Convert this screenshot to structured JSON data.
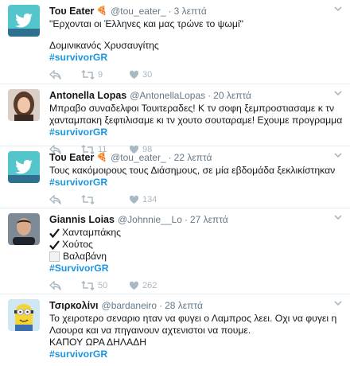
{
  "tweets": [
    {
      "name": "Του Eater",
      "emoji": "🍕",
      "handle": "@tou_eater_",
      "time": "3 λεπτά",
      "lines": [
        "\"Ερχονται οι Έλληνες και μας τρώνε το ψωμί\"",
        "",
        "Δομινικανός Χρυσαυγίτης"
      ],
      "hashtag": "#survivorGR",
      "retweets": "9",
      "likes": "30",
      "avatar": "twitter-bird-cyan"
    },
    {
      "name": "Antonella Lopas",
      "handle": "@AntonellaLopas",
      "time": "20 λεπτά",
      "text_a": "Μπραβο συναδελφοι Τουιτεραδες! Κ τν σοφη ξεμπροστιασαμε κ τν χανταμπακη ξεφτιλισαμε κι τν χουτο σουταραμε! Εχουμε προγραμμα",
      "hashtag": "#survivorGR",
      "retweets": "11",
      "likes": "98",
      "avatar": "photo-woman"
    },
    {
      "name": "Του Eater",
      "emoji": "🍕",
      "handle": "@tou_eater_",
      "time": "22 λεπτά",
      "lines": [
        "Τους κακόμοιρους τους Διάσημους, σε μία εβδομάδα ξεκλικίστηκαν"
      ],
      "hashtag": "#survivorGR",
      "retweets": "",
      "likes": "134",
      "avatar": "twitter-bird-cyan"
    },
    {
      "name": "Giannis Loias",
      "handle": "@Johnnie__Lo",
      "time": "27 λεπτά",
      "checks": [
        {
          "mark": "tick",
          "label": "Χανταμπάκης"
        },
        {
          "mark": "tick",
          "label": "Χούτος"
        },
        {
          "mark": "box",
          "label": "Βαλαβάνη"
        }
      ],
      "hashtag": "#SurvivorGR",
      "retweets": "50",
      "likes": "262",
      "avatar": "photo-man"
    },
    {
      "name": "Τσιρκολίνι",
      "handle": "@bardaneiro",
      "time": "28 λεπτά",
      "lines": [
        "Το χειροτερο σεναριο ηταν να φυγει ο Λαμπρος λεει. Οχι να φυγει η Λαουρα και να πηγαινουν αχτενιστοι να πουμε.",
        "ΚΑΠΟΥ ΩΡΑ ΔΗΛΑΔΗ"
      ],
      "hashtag": "#survivorGR",
      "avatar": "minion"
    }
  ],
  "colors": {
    "hashtag": "#1b95e0",
    "meta": "#657786",
    "icon": "#aab8c2",
    "divider": "#e6ecf0"
  }
}
